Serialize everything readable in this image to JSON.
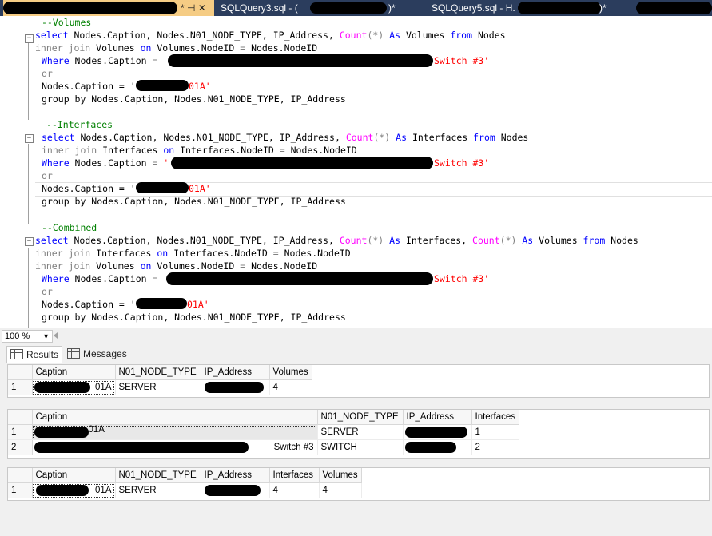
{
  "tabs": [
    {
      "label": "* ⊣ ✕",
      "active": true
    },
    {
      "label": "SQLQuery3.sql - (",
      "suffix": ")*",
      "active": false
    },
    {
      "label": "SQLQuery5.sql - H.",
      "suffix": ")*",
      "active": false
    }
  ],
  "editor": {
    "volumes_comment": "--Volumes",
    "interfaces_comment": "--Interfaces",
    "combined_comment": "--Combined",
    "switch_text": "Switch #3'",
    "caption_suffix": "01A'",
    "caption_prefix": "Nodes.Caption = '",
    "or": "or",
    "group_by": "group by Nodes.Caption, Nodes.N01_NODE_TYPE, IP_Address"
  },
  "zoom": {
    "value": "100 %"
  },
  "results_tabs": {
    "results": "Results",
    "messages": "Messages"
  },
  "grid1": {
    "headers": [
      "Caption",
      "N01_NODE_TYPE",
      "IP_Address",
      "Volumes"
    ],
    "rows": [
      {
        "n": "1",
        "caption": "01A",
        "type": "SERVER",
        "ip": "",
        "count": "4"
      }
    ]
  },
  "grid2": {
    "headers": [
      "Caption",
      "N01_NODE_TYPE",
      "IP_Address",
      "Interfaces"
    ],
    "rows": [
      {
        "n": "1",
        "caption": "01A",
        "type": "SERVER",
        "ip": "",
        "count": "1"
      },
      {
        "n": "2",
        "caption": "Switch #3",
        "type": "SWITCH",
        "ip": "",
        "count": "2"
      }
    ]
  },
  "grid3": {
    "headers": [
      "Caption",
      "N01_NODE_TYPE",
      "IP_Address",
      "Interfaces",
      "Volumes"
    ],
    "rows": [
      {
        "n": "1",
        "caption": "01A",
        "type": "SERVER",
        "ip": "",
        "interfaces": "4",
        "volumes": "4"
      }
    ]
  }
}
